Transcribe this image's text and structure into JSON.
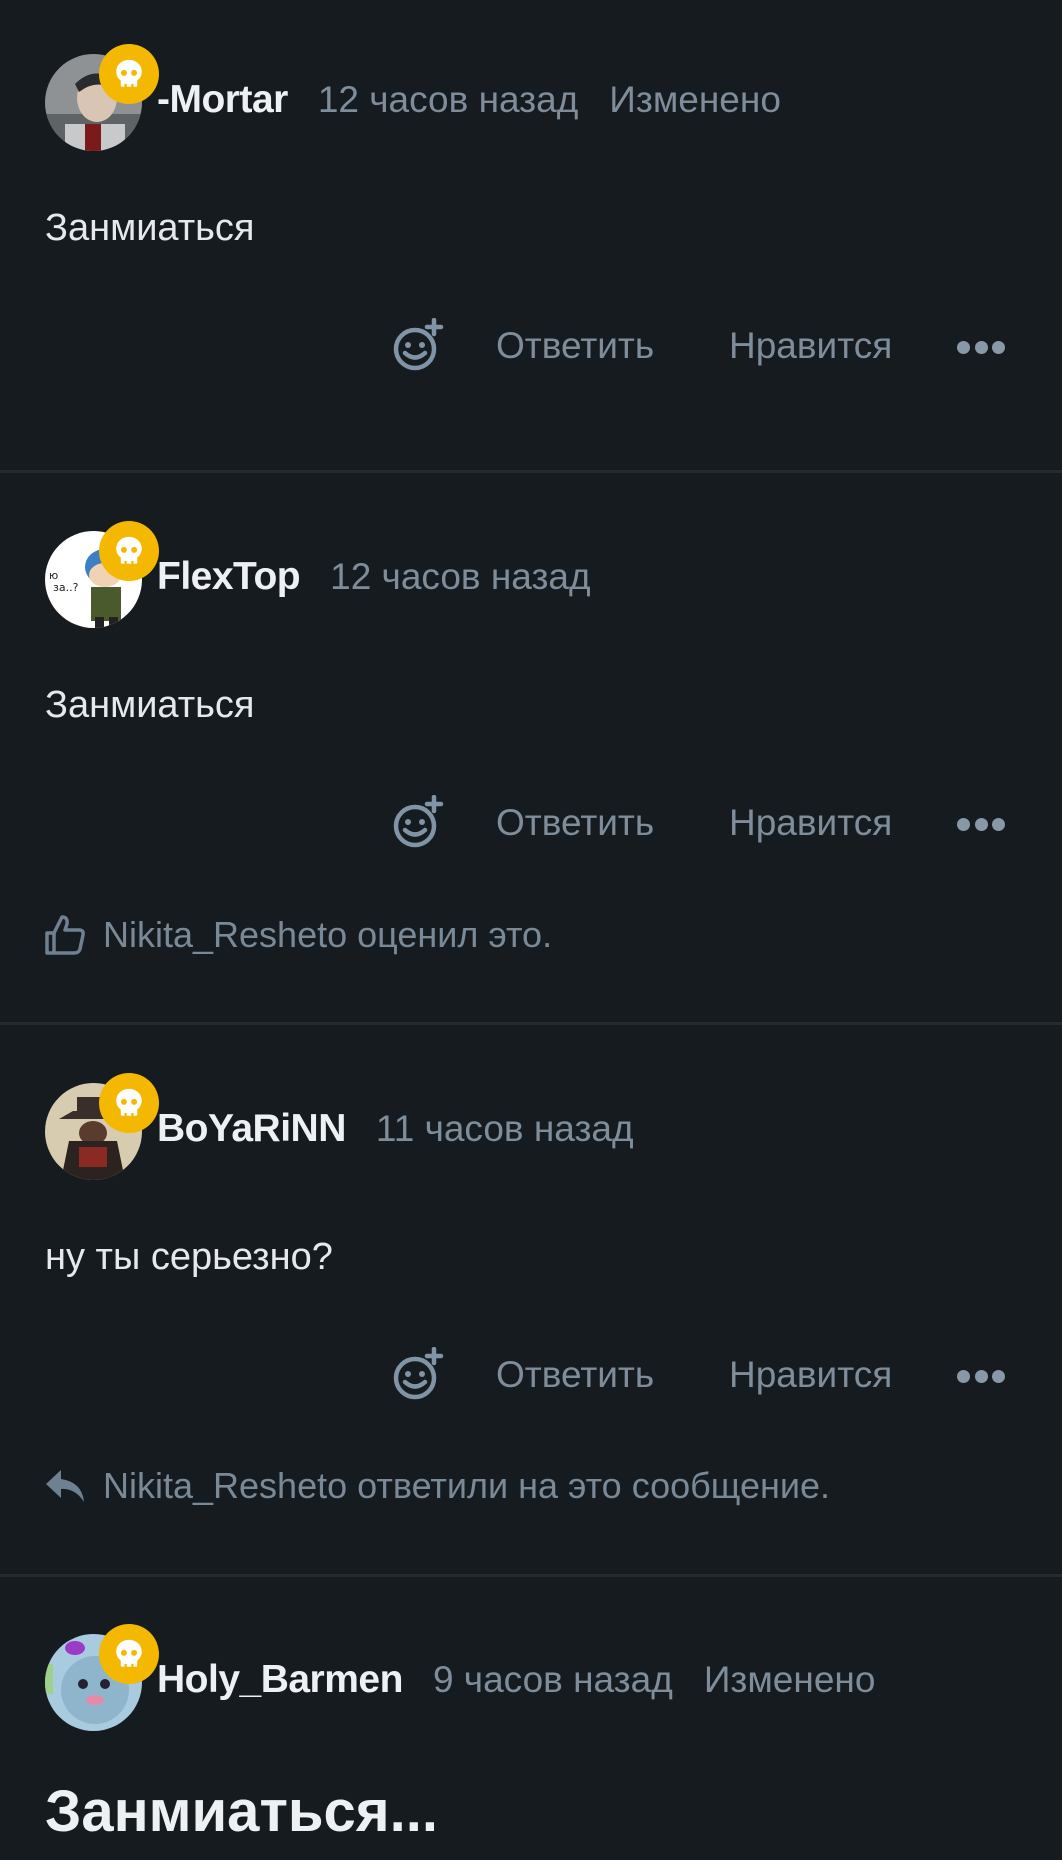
{
  "comments": [
    {
      "author": "-Mortar",
      "time": "12 часов назад",
      "edited": "Изменено",
      "text": "Занмиаться",
      "actions": {
        "reply": "Ответить",
        "like": "Нравится"
      }
    },
    {
      "author": "FlexTop",
      "time": "12 часов назад",
      "text": "Занмиаться",
      "actions": {
        "reply": "Ответить",
        "like": "Нравится"
      },
      "reaction_note": "Nikita_Resheto оценил это."
    },
    {
      "author": "BoYaRiNN",
      "time": "11 часов назад",
      "text": "ну ты серьезно?",
      "actions": {
        "reply": "Ответить",
        "like": "Нравится"
      },
      "reply_note": "Nikita_Resheto ответили на это сообщение."
    },
    {
      "author": "Holy_Barmen",
      "time": "9 часов назад",
      "edited": "Изменено",
      "text": "Занмиаться..."
    }
  ],
  "icons": {
    "badge": "skull-icon",
    "react": "add-reaction-icon",
    "more": "more-icon",
    "like_note": "thumbs-up-icon",
    "reply_note": "reply-icon"
  },
  "colors": {
    "background": "#161b20",
    "badge": "#f5b800",
    "muted_text": "#7e8d99",
    "primary_text": "#e8ebee"
  }
}
